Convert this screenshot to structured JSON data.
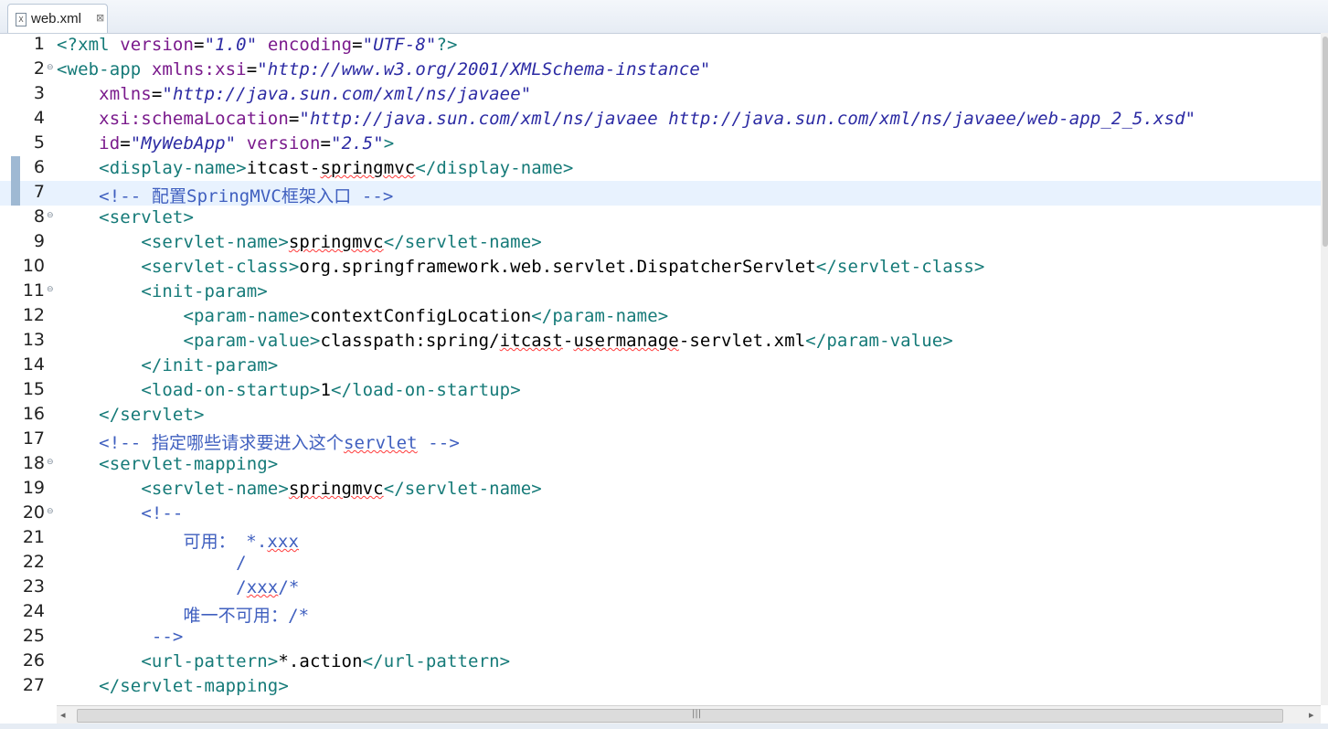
{
  "tab": {
    "filename": "web.xml",
    "icon": "xml-file-icon",
    "close_glyph": "⊠"
  },
  "colors": {
    "tag": "#157a78",
    "attr": "#7a1a8c",
    "string": "#2b2aa3",
    "comment": "#3f5fbf",
    "text": "#000000",
    "current_line": "#e8f2fe"
  },
  "lines": [
    {
      "n": "1",
      "fold": false,
      "current": false,
      "marker": false,
      "parts": [
        {
          "c": "pi",
          "t": "<?xml "
        },
        {
          "c": "attr",
          "t": "version"
        },
        {
          "c": "txt",
          "t": "="
        },
        {
          "c": "str",
          "t": "\"1.0\""
        },
        {
          "c": "txt",
          "t": " "
        },
        {
          "c": "attr",
          "t": "encoding"
        },
        {
          "c": "txt",
          "t": "="
        },
        {
          "c": "str",
          "t": "\"UTF-8\""
        },
        {
          "c": "pi",
          "t": "?>"
        }
      ]
    },
    {
      "n": "2",
      "fold": true,
      "current": false,
      "marker": false,
      "parts": [
        {
          "c": "tag",
          "t": "<web-app "
        },
        {
          "c": "attr",
          "t": "xmlns:xsi"
        },
        {
          "c": "txt",
          "t": "="
        },
        {
          "c": "str",
          "t": "\"http://www.w3.org/2001/XMLSchema-instance\""
        }
      ]
    },
    {
      "n": "3",
      "fold": false,
      "current": false,
      "marker": false,
      "parts": [
        {
          "c": "txt",
          "t": "    "
        },
        {
          "c": "attr",
          "t": "xmlns"
        },
        {
          "c": "txt",
          "t": "="
        },
        {
          "c": "str",
          "t": "\"http://java.sun.com/xml/ns/javaee\""
        }
      ]
    },
    {
      "n": "4",
      "fold": false,
      "current": false,
      "marker": false,
      "parts": [
        {
          "c": "txt",
          "t": "    "
        },
        {
          "c": "attr",
          "t": "xsi:schemaLocation"
        },
        {
          "c": "txt",
          "t": "="
        },
        {
          "c": "str",
          "t": "\"http://java.sun.com/xml/ns/javaee http://java.sun.com/xml/ns/javaee/web-app_2_5.xsd\""
        }
      ]
    },
    {
      "n": "5",
      "fold": false,
      "current": false,
      "marker": false,
      "parts": [
        {
          "c": "txt",
          "t": "    "
        },
        {
          "c": "attr",
          "t": "id"
        },
        {
          "c": "txt",
          "t": "="
        },
        {
          "c": "str",
          "t": "\"MyWebApp\""
        },
        {
          "c": "txt",
          "t": " "
        },
        {
          "c": "attr",
          "t": "version"
        },
        {
          "c": "txt",
          "t": "="
        },
        {
          "c": "str",
          "t": "\"2.5\""
        },
        {
          "c": "tag",
          "t": ">"
        }
      ]
    },
    {
      "n": "6",
      "fold": false,
      "current": false,
      "marker": true,
      "parts": [
        {
          "c": "txt",
          "t": "    "
        },
        {
          "c": "tag",
          "t": "<display-name>"
        },
        {
          "c": "txt",
          "t": "itcast-"
        },
        {
          "c": "txt sq",
          "t": "springmvc"
        },
        {
          "c": "tag",
          "t": "</display-name>"
        }
      ]
    },
    {
      "n": "7",
      "fold": false,
      "current": true,
      "marker": true,
      "parts": [
        {
          "c": "txt",
          "t": "    "
        },
        {
          "c": "cmt",
          "t": "<!-- 配置SpringMVC框架入口 -->"
        }
      ]
    },
    {
      "n": "8",
      "fold": true,
      "current": false,
      "marker": false,
      "parts": [
        {
          "c": "txt",
          "t": "    "
        },
        {
          "c": "tag",
          "t": "<servlet>"
        }
      ]
    },
    {
      "n": "9",
      "fold": false,
      "current": false,
      "marker": false,
      "parts": [
        {
          "c": "txt",
          "t": "        "
        },
        {
          "c": "tag",
          "t": "<servlet-name>"
        },
        {
          "c": "txt sq",
          "t": "springmvc"
        },
        {
          "c": "tag",
          "t": "</servlet-name>"
        }
      ]
    },
    {
      "n": "10",
      "fold": false,
      "current": false,
      "marker": false,
      "parts": [
        {
          "c": "txt",
          "t": "        "
        },
        {
          "c": "tag",
          "t": "<servlet-class>"
        },
        {
          "c": "txt",
          "t": "org.springframework.web.servlet.DispatcherServlet"
        },
        {
          "c": "tag",
          "t": "</servlet-class>"
        }
      ]
    },
    {
      "n": "11",
      "fold": true,
      "current": false,
      "marker": false,
      "parts": [
        {
          "c": "txt",
          "t": "        "
        },
        {
          "c": "tag",
          "t": "<init-param>"
        }
      ]
    },
    {
      "n": "12",
      "fold": false,
      "current": false,
      "marker": false,
      "parts": [
        {
          "c": "txt",
          "t": "            "
        },
        {
          "c": "tag",
          "t": "<param-name>"
        },
        {
          "c": "txt",
          "t": "contextConfigLocation"
        },
        {
          "c": "tag",
          "t": "</param-name>"
        }
      ]
    },
    {
      "n": "13",
      "fold": false,
      "current": false,
      "marker": false,
      "parts": [
        {
          "c": "txt",
          "t": "            "
        },
        {
          "c": "tag",
          "t": "<param-value>"
        },
        {
          "c": "txt",
          "t": "classpath:spring/"
        },
        {
          "c": "txt sq",
          "t": "itcast"
        },
        {
          "c": "txt",
          "t": "-"
        },
        {
          "c": "txt sq",
          "t": "usermanage"
        },
        {
          "c": "txt",
          "t": "-servlet.xml"
        },
        {
          "c": "tag",
          "t": "</param-value>"
        }
      ]
    },
    {
      "n": "14",
      "fold": false,
      "current": false,
      "marker": false,
      "parts": [
        {
          "c": "txt",
          "t": "        "
        },
        {
          "c": "tag",
          "t": "</init-param>"
        }
      ]
    },
    {
      "n": "15",
      "fold": false,
      "current": false,
      "marker": false,
      "parts": [
        {
          "c": "txt",
          "t": "        "
        },
        {
          "c": "tag",
          "t": "<load-on-startup>"
        },
        {
          "c": "txt",
          "t": "1"
        },
        {
          "c": "tag",
          "t": "</load-on-startup>"
        }
      ]
    },
    {
      "n": "16",
      "fold": false,
      "current": false,
      "marker": false,
      "parts": [
        {
          "c": "txt",
          "t": "    "
        },
        {
          "c": "tag",
          "t": "</servlet>"
        }
      ]
    },
    {
      "n": "17",
      "fold": false,
      "current": false,
      "marker": false,
      "parts": [
        {
          "c": "txt",
          "t": "    "
        },
        {
          "c": "cmt",
          "t": "<!-- 指定哪些请求要进入这个"
        },
        {
          "c": "cmt sq",
          "t": "servlet"
        },
        {
          "c": "cmt",
          "t": " -->"
        }
      ]
    },
    {
      "n": "18",
      "fold": true,
      "current": false,
      "marker": false,
      "parts": [
        {
          "c": "txt",
          "t": "    "
        },
        {
          "c": "tag",
          "t": "<servlet-mapping>"
        }
      ]
    },
    {
      "n": "19",
      "fold": false,
      "current": false,
      "marker": false,
      "parts": [
        {
          "c": "txt",
          "t": "        "
        },
        {
          "c": "tag",
          "t": "<servlet-name>"
        },
        {
          "c": "txt sq",
          "t": "springmvc"
        },
        {
          "c": "tag",
          "t": "</servlet-name>"
        }
      ]
    },
    {
      "n": "20",
      "fold": true,
      "current": false,
      "marker": false,
      "parts": [
        {
          "c": "txt",
          "t": "        "
        },
        {
          "c": "cmt",
          "t": "<!--"
        }
      ]
    },
    {
      "n": "21",
      "fold": false,
      "current": false,
      "marker": false,
      "parts": [
        {
          "c": "txt",
          "t": "            "
        },
        {
          "c": "cmt",
          "t": "可用： *."
        },
        {
          "c": "cmt sq",
          "t": "xxx"
        }
      ]
    },
    {
      "n": "22",
      "fold": false,
      "current": false,
      "marker": false,
      "parts": [
        {
          "c": "txt",
          "t": "                 "
        },
        {
          "c": "cmt",
          "t": "/"
        }
      ]
    },
    {
      "n": "23",
      "fold": false,
      "current": false,
      "marker": false,
      "parts": [
        {
          "c": "txt",
          "t": "                 "
        },
        {
          "c": "cmt",
          "t": "/"
        },
        {
          "c": "cmt sq",
          "t": "xxx"
        },
        {
          "c": "cmt",
          "t": "/*"
        }
      ]
    },
    {
      "n": "24",
      "fold": false,
      "current": false,
      "marker": false,
      "parts": [
        {
          "c": "txt",
          "t": "            "
        },
        {
          "c": "cmt",
          "t": "唯一不可用：/*"
        }
      ]
    },
    {
      "n": "25",
      "fold": false,
      "current": false,
      "marker": false,
      "parts": [
        {
          "c": "txt",
          "t": "         "
        },
        {
          "c": "cmt",
          "t": "-->"
        }
      ]
    },
    {
      "n": "26",
      "fold": false,
      "current": false,
      "marker": false,
      "parts": [
        {
          "c": "txt",
          "t": "        "
        },
        {
          "c": "tag",
          "t": "<url-pattern>"
        },
        {
          "c": "txt",
          "t": "*.action"
        },
        {
          "c": "tag",
          "t": "</url-pattern>"
        }
      ]
    },
    {
      "n": "27",
      "fold": false,
      "current": false,
      "marker": false,
      "parts": [
        {
          "c": "txt",
          "t": "    "
        },
        {
          "c": "tag",
          "t": "</servlet-mapping>"
        }
      ]
    }
  ],
  "scrollbar": {
    "left_arrow": "◂",
    "right_arrow": "▸",
    "grip": "|||"
  }
}
